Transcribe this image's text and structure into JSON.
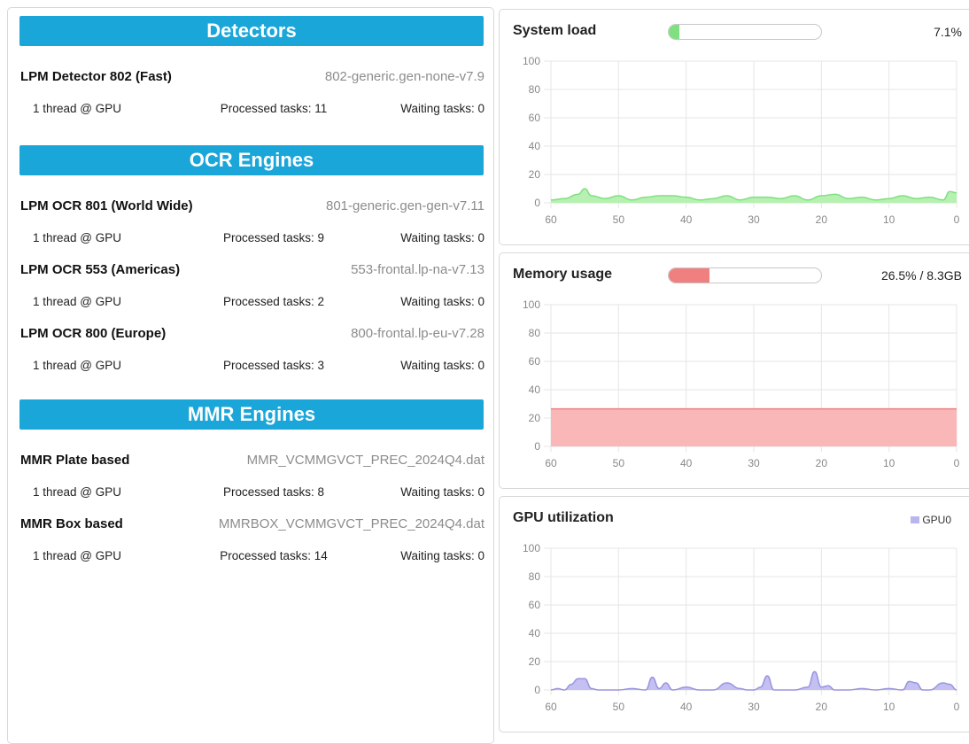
{
  "sections": [
    {
      "title": "Detectors",
      "engines": [
        {
          "name": "LPM Detector 802 (Fast)",
          "version": "802-generic.gen-none-v7.9",
          "threads": "1 thread @ GPU",
          "processed": "Processed tasks: 11",
          "waiting": "Waiting tasks: 0"
        }
      ]
    },
    {
      "title": "OCR Engines",
      "engines": [
        {
          "name": "LPM OCR 801 (World Wide)",
          "version": "801-generic.gen-gen-v7.11",
          "threads": "1 thread @ GPU",
          "processed": "Processed tasks: 9",
          "waiting": "Waiting tasks: 0"
        },
        {
          "name": "LPM OCR 553 (Americas)",
          "version": "553-frontal.lp-na-v7.13",
          "threads": "1 thread @ GPU",
          "processed": "Processed tasks: 2",
          "waiting": "Waiting tasks: 0"
        },
        {
          "name": "LPM OCR 800 (Europe)",
          "version": "800-frontal.lp-eu-v7.28",
          "threads": "1 thread @ GPU",
          "processed": "Processed tasks: 3",
          "waiting": "Waiting tasks: 0"
        }
      ]
    },
    {
      "title": "MMR Engines",
      "engines": [
        {
          "name": "MMR Plate based",
          "version": "MMR_VCMMGVCT_PREC_2024Q4.dat",
          "threads": "1 thread @ GPU",
          "processed": "Processed tasks: 8",
          "waiting": "Waiting tasks: 0"
        },
        {
          "name": "MMR Box based",
          "version": "MMRBOX_VCMMGVCT_PREC_2024Q4.dat",
          "threads": "1 thread @ GPU",
          "processed": "Processed tasks: 14",
          "waiting": "Waiting tasks: 0"
        }
      ]
    }
  ],
  "system_load": {
    "title": "System load",
    "value_text": "7.1%",
    "fraction": 0.071,
    "color": "#7fe07f",
    "fill": "#b6f1b2"
  },
  "memory_usage": {
    "title": "Memory usage",
    "value_text": "26.5% / 8.3GB",
    "fraction": 0.265,
    "color": "#f08080",
    "fill": "#f9b7b7"
  },
  "gpu_utilization": {
    "title": "GPU utilization",
    "legend": "GPU0",
    "color": "#9a94e0",
    "fill": "#c4c0f2"
  },
  "chart_data": [
    {
      "type": "area",
      "title": "System load",
      "x": [
        60,
        58,
        56,
        55,
        54,
        52,
        50,
        48,
        46,
        44,
        42,
        40,
        38,
        36,
        34,
        32,
        30,
        28,
        26,
        24,
        22,
        20,
        18,
        16,
        14,
        12,
        10,
        8,
        6,
        4,
        2,
        1,
        0
      ],
      "series": [
        {
          "values": [
            2,
            3,
            6,
            10,
            5,
            3,
            5,
            2,
            4,
            5,
            5,
            4,
            2,
            3,
            5,
            2,
            4,
            4,
            3,
            5,
            2,
            5,
            6,
            3,
            4,
            2,
            3,
            5,
            3,
            4,
            2,
            8,
            7
          ]
        }
      ],
      "ylim": [
        0,
        100
      ],
      "xlim": [
        60,
        0
      ],
      "xticks": [
        "60",
        "50",
        "40",
        "30",
        "20",
        "10",
        "0"
      ],
      "yticks": [
        "0",
        "20",
        "40",
        "60",
        "80",
        "100"
      ],
      "grid": true
    },
    {
      "type": "area",
      "title": "Memory usage",
      "x": [
        60,
        0
      ],
      "series": [
        {
          "values": [
            26.5,
            26.5
          ]
        }
      ],
      "ylim": [
        0,
        100
      ],
      "xlim": [
        60,
        0
      ],
      "xticks": [
        "60",
        "50",
        "40",
        "30",
        "20",
        "10",
        "0"
      ],
      "yticks": [
        "0",
        "20",
        "40",
        "60",
        "80",
        "100"
      ],
      "grid": true
    },
    {
      "type": "area",
      "title": "GPU utilization",
      "x": [
        60,
        59,
        58,
        57,
        56,
        55,
        54,
        53,
        52,
        50,
        48,
        46,
        45,
        44,
        43,
        42,
        40,
        38,
        36,
        34,
        32,
        31,
        30,
        29,
        28,
        27,
        26,
        24,
        22,
        21,
        20,
        19,
        18,
        16,
        14,
        12,
        10,
        8,
        7,
        6,
        5,
        4,
        2,
        1,
        0
      ],
      "series": [
        {
          "name": "GPU0",
          "values": [
            0,
            1,
            0,
            4,
            8,
            8,
            1,
            0,
            0,
            0,
            1,
            0,
            9,
            1,
            5,
            0,
            2,
            0,
            0,
            5,
            1,
            0,
            0,
            2,
            10,
            0,
            0,
            0,
            2,
            13,
            2,
            3,
            0,
            0,
            1,
            0,
            1,
            0,
            6,
            5,
            0,
            0,
            5,
            4,
            0
          ]
        }
      ],
      "ylim": [
        0,
        100
      ],
      "xlim": [
        60,
        0
      ],
      "xticks": [
        "60",
        "50",
        "40",
        "30",
        "20",
        "10",
        "0"
      ],
      "yticks": [
        "0",
        "20",
        "40",
        "60",
        "80",
        "100"
      ],
      "grid": true
    }
  ]
}
